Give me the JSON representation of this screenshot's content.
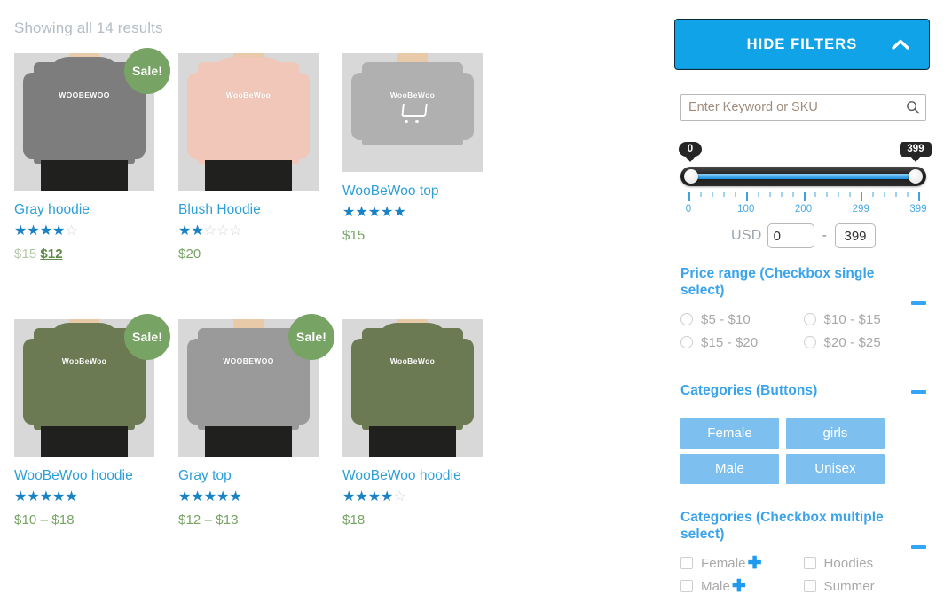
{
  "results": {
    "count_text": "Showing all 14 results"
  },
  "products": [
    {
      "title": "Gray hoodie",
      "rating": 4,
      "rating_max": 5,
      "price_regular": "$15",
      "price_sale": "$12",
      "price": "",
      "on_sale": true,
      "sale_label": "Sale!",
      "image_type": "hoodie",
      "image_color": "#7d7d7d",
      "image_logo": "WOOBEWOO",
      "thumb_size": "tall"
    },
    {
      "title": "Blush Hoodie",
      "rating": 2,
      "rating_max": 5,
      "price": "$20",
      "on_sale": false,
      "sale_label": "",
      "image_type": "hoodie",
      "image_color": "#f0c7b8",
      "image_logo": "WooBeWoo",
      "thumb_size": "tall"
    },
    {
      "title": "WooBeWoo top",
      "rating": 5,
      "rating_max": 5,
      "price": "$15",
      "on_sale": false,
      "sale_label": "",
      "image_type": "tshirt",
      "image_color": "#b0b0b0",
      "image_logo": "WooBeWoo",
      "thumb_size": "short"
    },
    {
      "title": "WooBeWoo hoodie",
      "rating": 5,
      "rating_max": 5,
      "price": "$10 – $18",
      "on_sale": true,
      "sale_label": "Sale!",
      "image_type": "hoodie",
      "image_color": "#6b7a52",
      "image_logo": "WooBeWoo",
      "thumb_size": "tall"
    },
    {
      "title": "Gray top",
      "rating": 5,
      "rating_max": 5,
      "price": "$12 – $13",
      "on_sale": true,
      "sale_label": "Sale!",
      "image_type": "sweater",
      "image_color": "#9a9a9a",
      "image_logo": "WOOBEWOO",
      "thumb_size": "tall"
    },
    {
      "title": "WooBeWoo hoodie",
      "rating": 4,
      "rating_max": 5,
      "price": "$18",
      "on_sale": false,
      "sale_label": "",
      "image_type": "hoodie",
      "image_color": "#6b7a52",
      "image_logo": "WooBeWoo",
      "thumb_size": "tall"
    }
  ],
  "sidebar": {
    "toggle_button_label": "HIDE FILTERS",
    "toggle_icon": "chevron-up-icon",
    "search": {
      "placeholder": "Enter Keyword or SKU",
      "value": "",
      "icon": "search-icon"
    },
    "price_slider": {
      "min_tooltip": "0",
      "max_tooltip": "399",
      "currency_label": "USD",
      "min_value": "0",
      "max_value": "399",
      "separator": "-",
      "tick_labels": [
        "0",
        "100",
        "200",
        "299",
        "399"
      ],
      "tick_positions": [
        0,
        25,
        50,
        75,
        100
      ],
      "range_min": 0,
      "range_max": 399
    },
    "sections": [
      {
        "title": "Price range (Checkbox single select)",
        "collapse_icon": "minus-icon",
        "control": "radio",
        "options": [
          {
            "label": "$5 - $10",
            "checked": false
          },
          {
            "label": "$10 - $15",
            "checked": false
          },
          {
            "label": "$15 - $20",
            "checked": false
          },
          {
            "label": "$20 - $25",
            "checked": false
          }
        ]
      },
      {
        "title": "Categories (Buttons)",
        "collapse_icon": "minus-icon",
        "control": "buttons",
        "options": [
          {
            "label": "Female"
          },
          {
            "label": "girls"
          },
          {
            "label": "Male"
          },
          {
            "label": "Unisex"
          }
        ]
      },
      {
        "title": "Categories (Checkbox multiple select)",
        "collapse_icon": "minus-icon",
        "control": "checkbox",
        "options": [
          {
            "label": "Female",
            "checked": false,
            "has_expand": true
          },
          {
            "label": "Hoodies",
            "checked": false,
            "has_expand": false
          },
          {
            "label": "Male",
            "checked": false,
            "has_expand": true
          },
          {
            "label": "Summer",
            "checked": false,
            "has_expand": false
          }
        ]
      }
    ]
  },
  "colors": {
    "accent_blue": "#10a3e8",
    "link_blue": "#2e9fd8",
    "section_title_blue": "#3ba3ec",
    "button_blue": "#7dc0f0",
    "star_blue": "#1982c4",
    "price_green": "#77a464",
    "sale_badge_green": "#77a464",
    "muted_gray": "#a9a9a9"
  }
}
